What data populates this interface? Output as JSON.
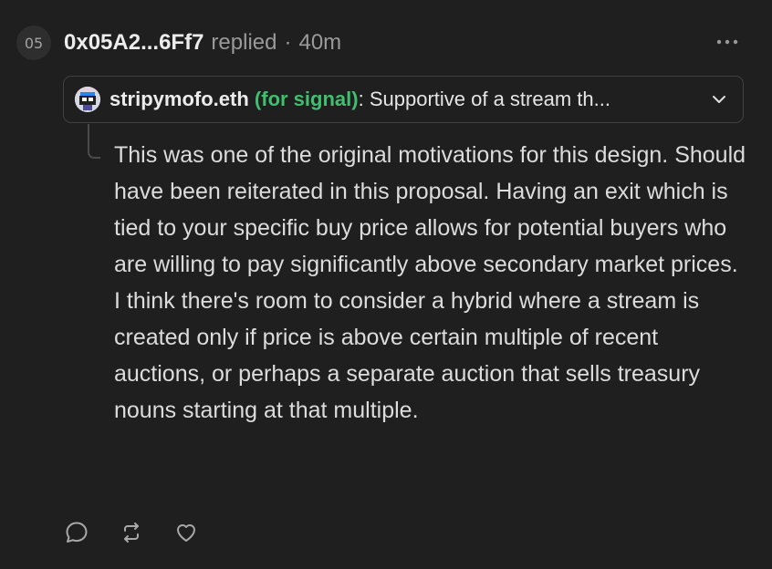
{
  "post": {
    "index": "05",
    "author": "0x05A2...6Ff7",
    "action": "replied",
    "separator": "·",
    "time": "40m"
  },
  "quote": {
    "author": "stripymofo.eth",
    "signal": "(for signal)",
    "colon": ":",
    "text": " Supportive of a stream th...",
    "signal_color": "#3fbf6f"
  },
  "body": {
    "paragraphs": [
      "This was one of the original motivations for this design. Should have been reiterated in this proposal. Having an exit which is tied to your specific buy price allows for potential buyers who are willing to pay significantly above secondary market prices.",
      "I think there's room to consider a hybrid where a stream is created only if price is above certain multiple of recent auctions, or perhaps a separate auction that sells treasury nouns starting at that multiple."
    ]
  },
  "icons": {
    "more": "more-horizontal-icon",
    "chevron": "chevron-down-icon",
    "reply": "reply-icon",
    "repost": "repost-icon",
    "like": "heart-icon",
    "avatar": "noun-avatar-icon"
  },
  "colors": {
    "background": "#1f1f1f",
    "muted": "#9a9a9a",
    "signal_for": "#3fbf6f"
  }
}
